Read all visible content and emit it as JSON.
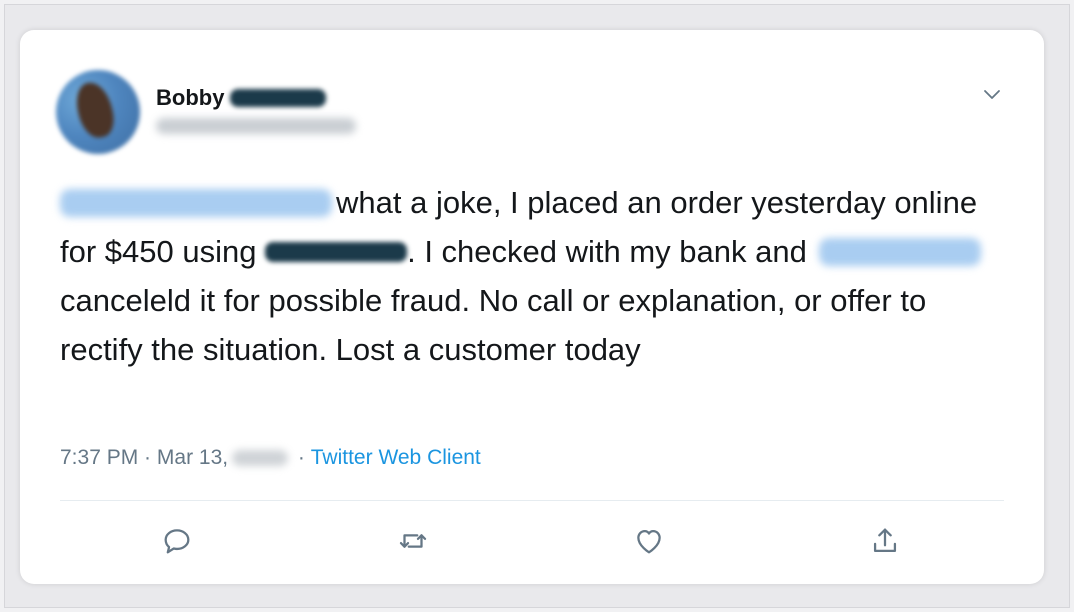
{
  "tweet": {
    "author": {
      "display_name": "Bobby"
    },
    "text": {
      "part1": "what a joke, I placed an order yesterday online for $450 using ",
      "part2": ". I checked with my bank and ",
      "part3": " canceleld it for possible fraud. No call or explanation, or offer to rectify the situation. Lost a customer today"
    },
    "meta": {
      "time": "7:37 PM",
      "separator": " · ",
      "date": "Mar 13,",
      "source_separator": " · ",
      "source": "Twitter Web Client"
    }
  },
  "actions": [
    {
      "icon": "reply-icon"
    },
    {
      "icon": "retweet-icon"
    },
    {
      "icon": "like-icon"
    },
    {
      "icon": "share-icon"
    }
  ],
  "colors": {
    "text": "#14171a",
    "secondary": "#657786",
    "link": "#1b95e0",
    "divider": "#e6ecf0"
  }
}
